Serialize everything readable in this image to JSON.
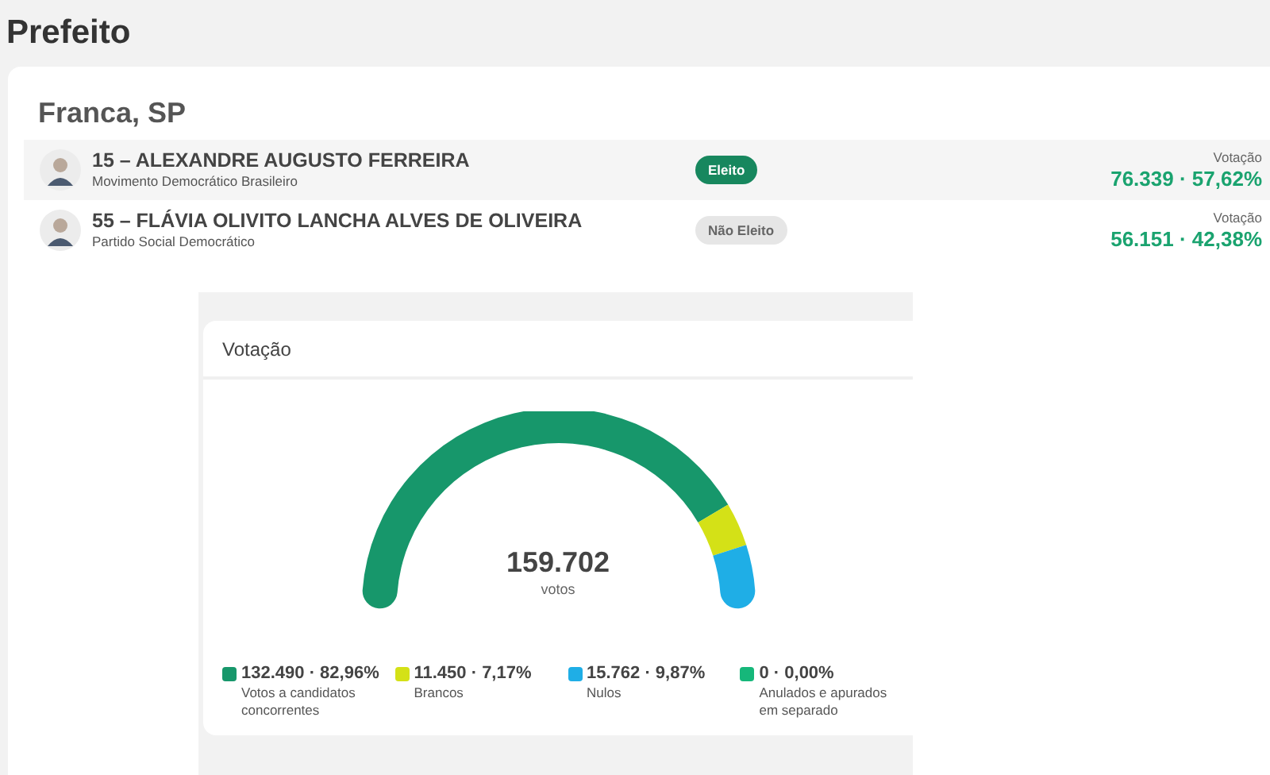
{
  "page_title": "Prefeito",
  "city": "Franca, SP",
  "candidates": [
    {
      "name": "15 – ALEXANDRE AUGUSTO FERREIRA",
      "party": "Movimento Democrático Brasileiro",
      "status": "Eleito",
      "elected": true,
      "votes_label": "Votação",
      "votes": "76.339 · 57,62%"
    },
    {
      "name": "55 – FLÁVIA OLIVITO LANCHA ALVES DE OLIVEIRA",
      "party": "Partido Social Democrático",
      "status": "Não Eleito",
      "elected": false,
      "votes_label": "Votação",
      "votes": "56.151 · 42,38%"
    }
  ],
  "votes_card": {
    "title": "Votação",
    "total": "159.702",
    "total_label": "votos",
    "chart_data": {
      "type": "donut",
      "categories": [
        "Votos a candidatos concorrentes",
        "Brancos",
        "Nulos",
        "Anulados e apurados em separado"
      ],
      "values": [
        82.96,
        7.17,
        9.87,
        0
      ]
    },
    "legend": [
      {
        "value": "132.490 · 82,96%",
        "color": "#17976b"
      },
      {
        "value": "11.450 · 7,17%",
        "color": "#d4e117"
      },
      {
        "value": "15.762 · 9,87%",
        "color": "#1faee6"
      },
      {
        "value": "0 · 0,00%",
        "color": "#16b77a"
      }
    ]
  }
}
